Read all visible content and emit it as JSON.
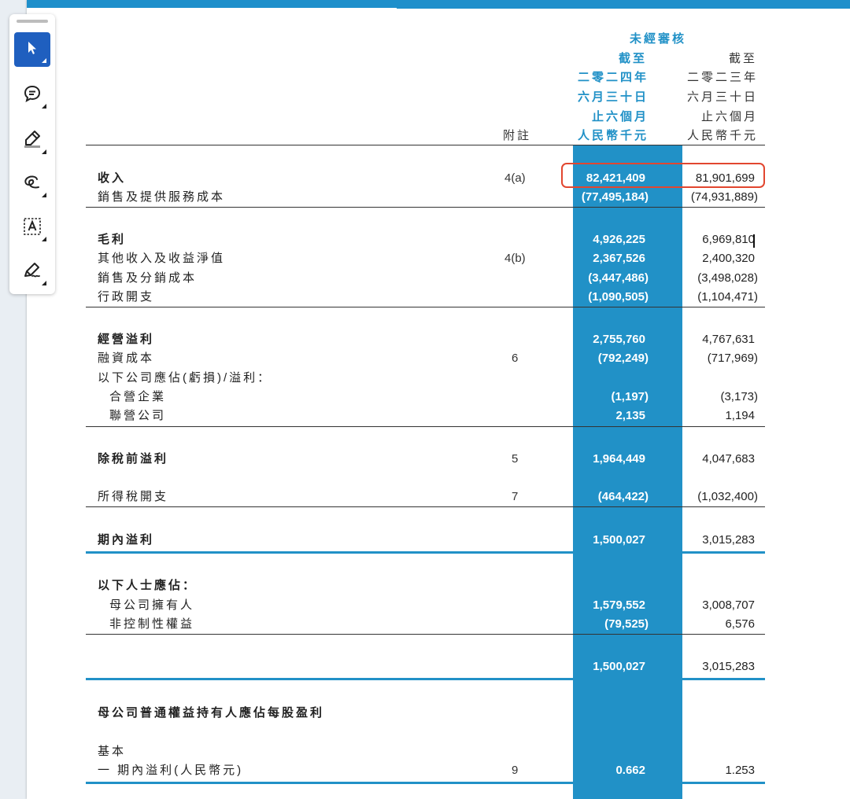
{
  "toolbar": {
    "tools": [
      {
        "name": "select-tool",
        "icon": "cursor-arrow-icon"
      },
      {
        "name": "comment-tool",
        "icon": "speech-bubble-icon"
      },
      {
        "name": "highlight-tool",
        "icon": "highlighter-pen-icon"
      },
      {
        "name": "draw-tool",
        "icon": "freehand-lasso-icon"
      },
      {
        "name": "text-box-tool",
        "icon": "text-box-icon"
      },
      {
        "name": "sign-tool",
        "icon": "signature-pen-icon"
      }
    ],
    "active_tool": "select-tool",
    "accent": "#1f5fbf"
  },
  "colors": {
    "brand_blue": "#2191c7",
    "highlight_red": "#e2462f"
  },
  "header": {
    "unaudited": "未經審核",
    "cur_line1": "截至",
    "cur_line2": "二零二四年",
    "cur_line3": "六月三十日",
    "cur_line4": "止六個月",
    "cur_line5": "人民幣千元",
    "prev_line1": "截至",
    "prev_line2": "二零二三年",
    "prev_line3": "六月三十日",
    "prev_line4": "止六個月",
    "prev_line5": "人民幣千元",
    "notes": "附註"
  },
  "rows": [
    {
      "label": "收入",
      "note": "4(a)",
      "cur": "82,421,409",
      "prev": "81,901,699"
    },
    {
      "label": "銷售及提供服務成本",
      "note": "",
      "cur": "(77,495,184)",
      "prev": "(74,931,889)"
    },
    {
      "label": "毛利",
      "note": "",
      "cur": "4,926,225",
      "prev": "6,969,810"
    },
    {
      "label": "其他收入及收益淨值",
      "note": "4(b)",
      "cur": "2,367,526",
      "prev": "2,400,320"
    },
    {
      "label": "銷售及分銷成本",
      "note": "",
      "cur": "(3,447,486)",
      "prev": "(3,498,028)"
    },
    {
      "label": "行政開支",
      "note": "",
      "cur": "(1,090,505)",
      "prev": "(1,104,471)"
    },
    {
      "label": "經營溢利",
      "note": "",
      "cur": "2,755,760",
      "prev": "4,767,631"
    },
    {
      "label": "融資成本",
      "note": "6",
      "cur": "(792,249)",
      "prev": "(717,969)"
    },
    {
      "label": "以下公司應佔(虧損)/溢利：",
      "note": "",
      "cur": "",
      "prev": ""
    },
    {
      "label": "合營企業",
      "note": "",
      "cur": "(1,197)",
      "prev": "(3,173)"
    },
    {
      "label": "聯營公司",
      "note": "",
      "cur": "2,135",
      "prev": "1,194"
    },
    {
      "label": "除稅前溢利",
      "note": "5",
      "cur": "1,964,449",
      "prev": "4,047,683"
    },
    {
      "label": "所得稅開支",
      "note": "7",
      "cur": "(464,422)",
      "prev": "(1,032,400)"
    },
    {
      "label": "期內溢利",
      "note": "",
      "cur": "1,500,027",
      "prev": "3,015,283"
    },
    {
      "label": "以下人士應佔：",
      "note": "",
      "cur": "",
      "prev": ""
    },
    {
      "label": "母公司擁有人",
      "note": "",
      "cur": "1,579,552",
      "prev": "3,008,707"
    },
    {
      "label": "非控制性權益",
      "note": "",
      "cur": "(79,525)",
      "prev": "6,576"
    },
    {
      "label": "",
      "note": "",
      "cur": "1,500,027",
      "prev": "3,015,283"
    },
    {
      "label": "母公司普通權益持有人應佔每股盈利",
      "note": "",
      "cur": "",
      "prev": ""
    },
    {
      "label": "基本",
      "note": "",
      "cur": "",
      "prev": ""
    },
    {
      "label": "一 期內溢利(人民幣元)",
      "note": "9",
      "cur": "0.662",
      "prev": "1.253"
    }
  ]
}
